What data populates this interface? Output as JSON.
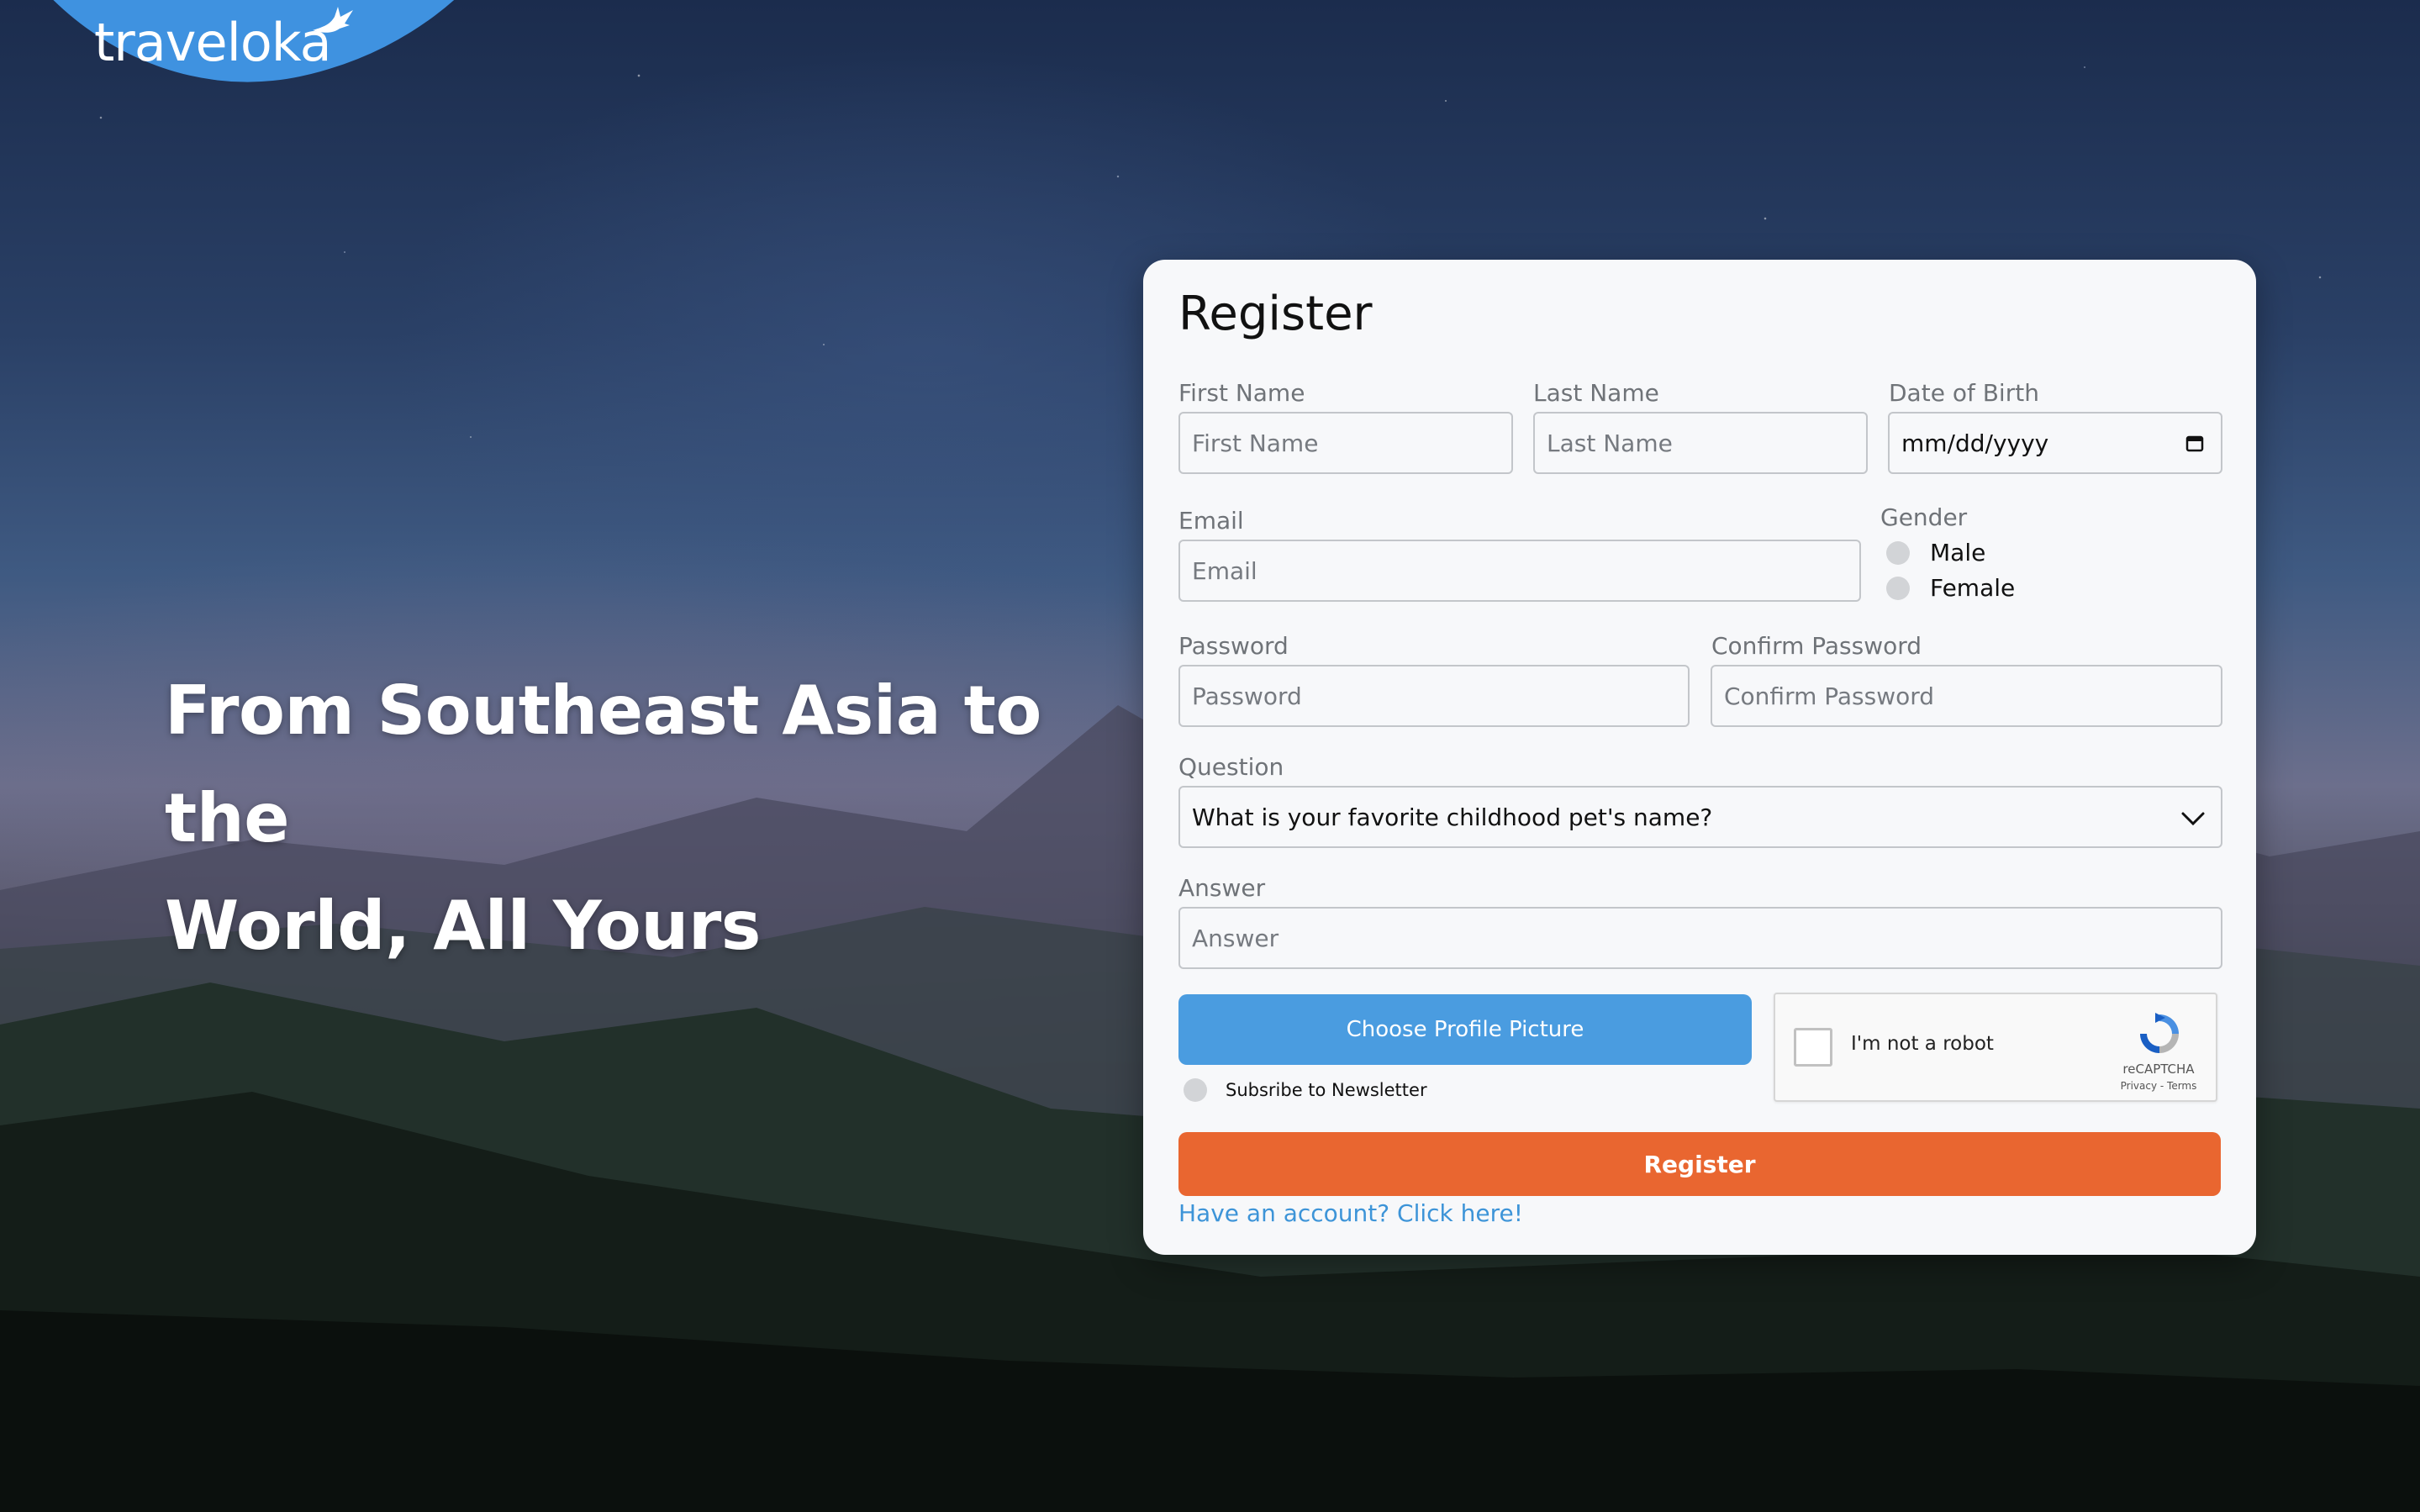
{
  "brand": {
    "name": "traveloka",
    "color": "#3f92e0"
  },
  "hero": {
    "line1": "From Southeast Asia to the",
    "line2": "World, All Yours"
  },
  "form": {
    "title": "Register",
    "first_name": {
      "label": "First Name",
      "placeholder": "First Name"
    },
    "last_name": {
      "label": "Last Name",
      "placeholder": "Last Name"
    },
    "dob": {
      "label": "Date of Birth",
      "value": "mm/dd/yyyy"
    },
    "email": {
      "label": "Email",
      "placeholder": "Email"
    },
    "gender": {
      "label": "Gender",
      "options": [
        "Male",
        "Female"
      ]
    },
    "password": {
      "label": "Password",
      "placeholder": "Password"
    },
    "confirm_password": {
      "label": "Confirm Password",
      "placeholder": "Confirm Password"
    },
    "question": {
      "label": "Question",
      "selected": "What is your favorite childhood pet's name?"
    },
    "answer": {
      "label": "Answer",
      "placeholder": "Answer"
    },
    "choose_picture_label": "Choose Profile Picture",
    "newsletter_label": "Subsribe to Newsletter",
    "captcha": {
      "text": "I'm not a robot",
      "brand": "reCAPTCHA",
      "links": "Privacy - Terms"
    },
    "register_label": "Register",
    "login_link": "Have an account? Click here!"
  },
  "colors": {
    "primary_button": "#4a9ce0",
    "register_button": "#e96630",
    "link": "#3d94d8"
  }
}
